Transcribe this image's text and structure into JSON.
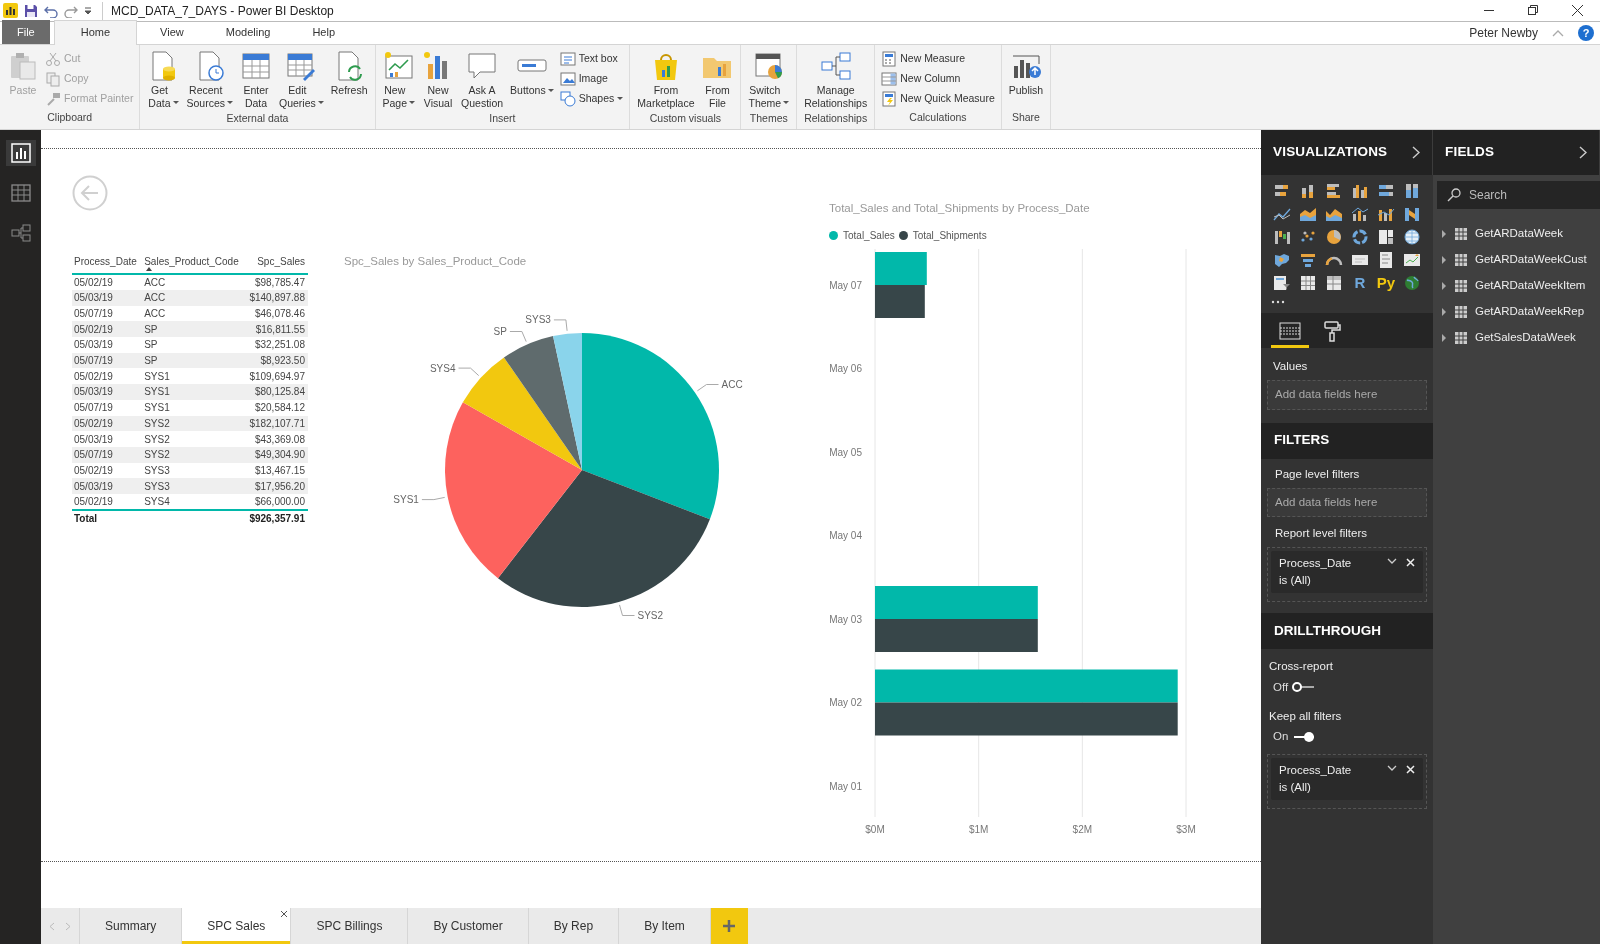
{
  "window": {
    "title": "MCD_DATA_7_DAYS - Power BI Desktop",
    "user": "Peter Newby",
    "help_glyph": "?"
  },
  "menu_tabs": [
    {
      "label": "File",
      "kind": "file",
      "selected": false
    },
    {
      "label": "Home",
      "kind": "tab",
      "selected": true
    },
    {
      "label": "View",
      "kind": "tab",
      "selected": false
    },
    {
      "label": "Modeling",
      "kind": "tab",
      "selected": false
    },
    {
      "label": "Help",
      "kind": "tab",
      "selected": false
    }
  ],
  "ribbon": [
    {
      "label": "Clipboard",
      "items": [
        {
          "kind": "large",
          "label": "Paste",
          "disabled": true,
          "dropdown": false
        },
        {
          "kind": "stack",
          "items": [
            {
              "label": "Cut",
              "disabled": true,
              "dropdown": false
            },
            {
              "label": "Copy",
              "disabled": true,
              "dropdown": false
            },
            {
              "label": "Format Painter",
              "disabled": true,
              "dropdown": false
            }
          ]
        }
      ]
    },
    {
      "label": "External data",
      "items": [
        {
          "kind": "large",
          "label": "Get Data",
          "disabled": false,
          "dropdown": true
        },
        {
          "kind": "large",
          "label": "Recent Sources",
          "disabled": false,
          "dropdown": true
        },
        {
          "kind": "large",
          "label": "Enter Data",
          "disabled": false,
          "dropdown": false
        },
        {
          "kind": "large",
          "label": "Edit Queries",
          "disabled": false,
          "dropdown": true
        },
        {
          "kind": "large",
          "label": "Refresh",
          "disabled": false,
          "dropdown": false
        }
      ]
    },
    {
      "label": "Insert",
      "items": [
        {
          "kind": "large",
          "label": "New Page",
          "disabled": false,
          "dropdown": true
        },
        {
          "kind": "large",
          "label": "New Visual",
          "disabled": false,
          "dropdown": false
        },
        {
          "kind": "large",
          "label": "Ask A Question",
          "disabled": false,
          "dropdown": false
        },
        {
          "kind": "large",
          "label": "Buttons",
          "disabled": false,
          "dropdown": true
        },
        {
          "kind": "stack",
          "items": [
            {
              "label": "Text box",
              "disabled": false,
              "dropdown": false
            },
            {
              "label": "Image",
              "disabled": false,
              "dropdown": false
            },
            {
              "label": "Shapes",
              "disabled": false,
              "dropdown": true
            }
          ]
        }
      ]
    },
    {
      "label": "Custom visuals",
      "items": [
        {
          "kind": "large",
          "label": "From Marketplace",
          "disabled": false,
          "dropdown": false
        },
        {
          "kind": "large",
          "label": "From File",
          "disabled": false,
          "dropdown": false
        }
      ]
    },
    {
      "label": "Themes",
      "items": [
        {
          "kind": "large",
          "label": "Switch Theme",
          "disabled": false,
          "dropdown": true
        }
      ]
    },
    {
      "label": "Relationships",
      "items": [
        {
          "kind": "large",
          "label": "Manage Relationships",
          "disabled": false,
          "dropdown": false
        }
      ]
    },
    {
      "label": "Calculations",
      "items": [
        {
          "kind": "stack",
          "items": [
            {
              "label": "New Measure",
              "disabled": false,
              "dropdown": false
            },
            {
              "label": "New Column",
              "disabled": false,
              "dropdown": false
            },
            {
              "label": "New Quick Measure",
              "disabled": false,
              "dropdown": false
            }
          ]
        }
      ]
    },
    {
      "label": "Share",
      "items": [
        {
          "kind": "large",
          "label": "Publish",
          "disabled": false,
          "dropdown": false
        }
      ]
    }
  ],
  "left_rail": [
    {
      "selected": true
    },
    {
      "selected": false
    },
    {
      "selected": false
    }
  ],
  "table_visual": {
    "columns": [
      {
        "label": "Process_Date",
        "sorted": false
      },
      {
        "label": "Sales_Product_Code",
        "sorted": true
      },
      {
        "label": "Spc_Sales",
        "sorted": false
      }
    ],
    "rows": [
      [
        "05/02/19",
        "ACC",
        "$98,785.47"
      ],
      [
        "05/03/19",
        "ACC",
        "$140,897.88"
      ],
      [
        "05/07/19",
        "ACC",
        "$46,078.46"
      ],
      [
        "05/02/19",
        "SP",
        "$16,811.55"
      ],
      [
        "05/03/19",
        "SP",
        "$32,251.08"
      ],
      [
        "05/07/19",
        "SP",
        "$8,923.50"
      ],
      [
        "05/02/19",
        "SYS1",
        "$109,694.97"
      ],
      [
        "05/03/19",
        "SYS1",
        "$80,125.84"
      ],
      [
        "05/07/19",
        "SYS1",
        "$20,584.12"
      ],
      [
        "05/02/19",
        "SYS2",
        "$182,107.71"
      ],
      [
        "05/03/19",
        "SYS2",
        "$43,369.08"
      ],
      [
        "05/07/19",
        "SYS2",
        "$49,304.90"
      ],
      [
        "05/02/19",
        "SYS3",
        "$13,467.15"
      ],
      [
        "05/03/19",
        "SYS3",
        "$17,956.20"
      ],
      [
        "05/02/19",
        "SYS4",
        "$66,000.00"
      ]
    ],
    "total": {
      "label": "Total",
      "value": "$926,357.91"
    }
  },
  "pie_visual": {
    "chart_data": {
      "type": "pie",
      "title": "Spc_Sales by Sales_Product_Code",
      "categories": [
        "ACC",
        "SYS2",
        "SYS1",
        "SYS4",
        "SP",
        "SYS3"
      ],
      "values": [
        30.85,
        29.66,
        22.71,
        7.13,
        6.26,
        3.39
      ],
      "colors": [
        "#01b8aa",
        "#374649",
        "#fd625e",
        "#f2c80f",
        "#5f6b6d",
        "#8ad4eb"
      ]
    }
  },
  "bar_visual": {
    "chart_data": {
      "type": "bar",
      "orientation": "horizontal",
      "title": "Total_Sales and Total_Shipments by Process_Date",
      "categories": [
        "May 07",
        "May 06",
        "May 05",
        "May 04",
        "May 03",
        "May 02",
        "May 01"
      ],
      "series": [
        {
          "name": "Total_Sales",
          "color": "#01b8aa",
          "values": [
            0.5,
            null,
            null,
            null,
            1.57,
            2.92,
            null
          ]
        },
        {
          "name": "Total_Shipments",
          "color": "#374649",
          "values": [
            0.48,
            null,
            null,
            null,
            1.57,
            2.92,
            null
          ]
        }
      ],
      "xlim": [
        0,
        3
      ],
      "xticks": [
        {
          "value": 0,
          "label": "$0M"
        },
        {
          "value": 1,
          "label": "$1M"
        },
        {
          "value": 2,
          "label": "$2M"
        },
        {
          "value": 3,
          "label": "$3M"
        }
      ]
    }
  },
  "page_tabs": [
    {
      "label": "Summary",
      "selected": false
    },
    {
      "label": "SPC Sales",
      "selected": true
    },
    {
      "label": "SPC Billings",
      "selected": false
    },
    {
      "label": "By Customer",
      "selected": false
    },
    {
      "label": "By Rep",
      "selected": false
    },
    {
      "label": "By Item",
      "selected": false
    }
  ],
  "visualizations": {
    "title": "VISUALIZATIONS",
    "script_glyphs": [
      "R",
      "Py"
    ],
    "pane_tabs": [
      {
        "selected": true
      },
      {
        "selected": false
      }
    ],
    "values_label": "Values",
    "values_placeholder": "Add data fields here"
  },
  "filters": {
    "title": "FILTERS",
    "page_label": "Page level filters",
    "page_placeholder": "Add data fields here",
    "report_label": "Report level filters",
    "report_filters": [
      {
        "field": "Process_Date",
        "condition": "is (All)"
      }
    ]
  },
  "drillthrough": {
    "title": "DRILLTHROUGH",
    "options": [
      {
        "label": "Cross-report",
        "state_label": "Off",
        "on": false
      },
      {
        "label": "Keep all filters",
        "state_label": "On",
        "on": true
      }
    ],
    "filters": [
      {
        "field": "Process_Date",
        "condition": "is (All)"
      }
    ]
  },
  "fields": {
    "title": "FIELDS",
    "search_placeholder": "Search",
    "tables": [
      {
        "name": "GetARDataWeek",
        "expanded": false
      },
      {
        "name": "GetARDataWeekCust",
        "expanded": false
      },
      {
        "name": "GetARDataWeekItem",
        "expanded": false
      },
      {
        "name": "GetARDataWeekRep",
        "expanded": false
      },
      {
        "name": "GetSalesDataWeek",
        "expanded": false
      }
    ]
  }
}
